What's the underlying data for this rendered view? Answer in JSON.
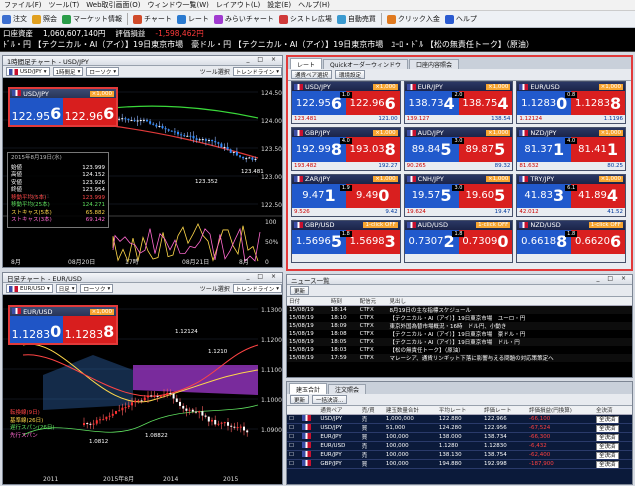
{
  "menu": [
    "ファイル(F)",
    "ツール(T)",
    "Web取引画面(O)",
    "ウィンドウ一覧(W)",
    "レイアウト(L)",
    "設定(E)",
    "ヘルプ(H)"
  ],
  "toolbar": [
    {
      "label": "注文",
      "icon": "order-icon",
      "color": "#3c6fd0"
    },
    {
      "label": "照会",
      "icon": "inquiry-icon",
      "color": "#e0a020"
    },
    {
      "label": "マーケット情報",
      "icon": "market-info-icon",
      "color": "#2a9d4a"
    },
    {
      "label": "チャート",
      "icon": "chart-icon",
      "color": "#d04a2a"
    },
    {
      "label": "レート",
      "icon": "rate-icon",
      "color": "#2a7ad0"
    },
    {
      "label": "みらいチャート",
      "icon": "mirai-chart-icon",
      "color": "#a03ad0"
    },
    {
      "label": "シストレ広場",
      "icon": "systrade-icon",
      "color": "#d03a3a"
    },
    {
      "label": "自動売買",
      "icon": "auto-trade-icon",
      "color": "#3a9ad0"
    },
    {
      "label": "クリック入金",
      "icon": "deposit-icon",
      "color": "#e07a20"
    },
    {
      "label": "ヘルプ",
      "icon": "help-icon",
      "color": "#2a5ad0"
    }
  ],
  "status": {
    "equity_label": "口座資産",
    "equity": "1,060,607,140",
    "unit": "円",
    "pl_label": "評価損益",
    "pl": "-1,598,462",
    "pl_unit": "円"
  },
  "ticker": "ﾄﾞﾙ・円     【テクニカル・AI（アイ）】19日東京市場　豪ドル・円     【テクニカル・AI（アイ）】19日東京市場　ﾕｰﾛ・ﾄﾞﾙ     【松の無責任トーク】（原油）",
  "chart1": {
    "title": "1時間足チャート - USD/JPY",
    "pair": "USD/JPY",
    "timeframe": "1時間足",
    "candle": "ローソク",
    "tool": "ツール選択",
    "line": "トレンドライン",
    "quote": {
      "pair": "USD/JPY",
      "lot": "×1,000",
      "bid": "122.95",
      "bid_pip": "6",
      "ask": "122.96",
      "ask_pip": "6",
      "spread": "1.0"
    },
    "y_labels": [
      "124.50",
      "124.00",
      "123.50",
      "123.00",
      "122.50"
    ],
    "y2_labels": [
      "100",
      "50%",
      "0"
    ],
    "x_labels": [
      "8月",
      "08月20日",
      "17時",
      "08月21日",
      "8月"
    ],
    "annotations": [
      "123.481",
      "123.352",
      "121.001"
    ],
    "info": {
      "date": "2015年8月19日(水)",
      "rows": [
        [
          "始値",
          "123.999"
        ],
        [
          "高値",
          "124.152"
        ],
        [
          "安値",
          "123.926"
        ],
        [
          "終値",
          "123.954"
        ]
      ],
      "ind": [
        [
          "移動平均(5本)",
          "123.999",
          "red"
        ],
        [
          "移動平均(25本)",
          "124.271",
          "grn"
        ],
        [
          "ストキャス(5本)",
          "65.882",
          "yel"
        ],
        [
          "ストキャス(3本)",
          "69.142",
          "pnk"
        ]
      ]
    }
  },
  "chart2": {
    "title": "日足チャート - EUR/USD",
    "pair": "EUR/USD",
    "timeframe": "日足",
    "candle": "ローソク",
    "tool": "ツール選択",
    "line": "トレンドライン",
    "quote": {
      "pair": "EUR/USD",
      "lot": "×1,000",
      "bid": "1.1283",
      "bid_pip": "0",
      "ask": "1.1283",
      "ask_pip": "8",
      "spread": "0.8"
    },
    "y_labels": [
      "1.1300",
      "1.1200",
      "1.1100",
      "1.1000",
      "1.0900"
    ],
    "x_labels": [
      "2011",
      "2015年8月",
      "2014",
      "2015"
    ],
    "annotations": [
      "1.12124",
      "1.08822",
      "1.1210",
      "1.0812"
    ],
    "legend": [
      [
        "転換線(9日)",
        "#ff4444"
      ],
      [
        "基準線(26日)",
        "#ffd84a"
      ],
      [
        "遅行スパン(26日)",
        "#5fe05f"
      ],
      [
        "先行スパン",
        "#ff6ad0"
      ]
    ]
  },
  "rate": {
    "title": "レート",
    "tabs": [
      "レート",
      "Quickオーダーウィンドウ",
      "口座内容照会"
    ],
    "buttons": [
      "通貨ペア選択",
      "環境設定"
    ],
    "tiles": [
      {
        "pair": "USD/JPY",
        "lot": "×1,000",
        "bid": "122.95",
        "bp": "6",
        "ask": "122.96",
        "ap": "6",
        "sp": "1.0",
        "lo": "123.481",
        "hi": "121.00"
      },
      {
        "pair": "EUR/JPY",
        "lot": "×1,000",
        "bid": "138.73",
        "bp": "4",
        "ask": "138.75",
        "ap": "4",
        "sp": "2.0",
        "lo": "139.127",
        "hi": "138.54"
      },
      {
        "pair": "EUR/USD",
        "lot": "×1,000",
        "bid": "1.1283",
        "bp": "0",
        "ask": "1.1283",
        "ap": "8",
        "sp": "0.8",
        "lo": "1.12124",
        "hi": "1.1196"
      },
      {
        "pair": "GBP/JPY",
        "lot": "×1,000",
        "bid": "192.99",
        "bp": "8",
        "ask": "193.03",
        "ap": "8",
        "sp": "4.0",
        "lo": "193.482",
        "hi": "192.27"
      },
      {
        "pair": "AUD/JPY",
        "lot": "×1,000",
        "bid": "89.84",
        "bp": "5",
        "ask": "89.87",
        "ap": "5",
        "sp": "3.0",
        "lo": "90.265",
        "hi": "89.32"
      },
      {
        "pair": "NZD/JPY",
        "lot": "×1,000",
        "bid": "81.37",
        "bp": "1",
        "ask": "81.41",
        "ap": "1",
        "sp": "4.0",
        "lo": "81.632",
        "hi": "80.25"
      },
      {
        "pair": "ZAR/JPY",
        "lot": "×1,000",
        "bid": "9.47",
        "bp": "1",
        "ask": "9.49",
        "ap": "0",
        "sp": "1.9",
        "lo": "9.526",
        "hi": "9.42"
      },
      {
        "pair": "CNH/JPY",
        "lot": "×1,000",
        "bid": "19.57",
        "bp": "5",
        "ask": "19.60",
        "ap": "5",
        "sp": "3.0",
        "lo": "19.624",
        "hi": "19.47"
      },
      {
        "pair": "TRY/JPY",
        "lot": "×1,000",
        "bid": "41.83",
        "bp": "3",
        "ask": "41.89",
        "ap": "4",
        "sp": "6.1",
        "lo": "42.012",
        "hi": "41.52"
      },
      {
        "pair": "GBP/USD",
        "lot": "1-click OFF",
        "bid": "1.5696",
        "bp": "5",
        "ask": "1.5698",
        "ap": "3",
        "sp": "1.8",
        "lo": "",
        "hi": ""
      },
      {
        "pair": "AUD/USD",
        "lot": "1-click OFF",
        "bid": "0.7307",
        "bp": "2",
        "ask": "0.7309",
        "ap": "0",
        "sp": "1.8",
        "lo": "",
        "hi": ""
      },
      {
        "pair": "NZD/USD",
        "lot": "1-click OFF",
        "bid": "0.6618",
        "bp": "8",
        "ask": "0.6620",
        "ap": "6",
        "sp": "1.8",
        "lo": "",
        "hi": ""
      }
    ]
  },
  "news": {
    "title": "ニュース一覧",
    "refresh": "更新",
    "headers": [
      "日付",
      "時刻",
      "配信元",
      "見出し"
    ],
    "rows": [
      [
        "15/08/19",
        "18:14",
        "CTFX",
        "8月19日の主な指標スケジュール"
      ],
      [
        "15/08/19",
        "18:10",
        "CTFX",
        "【テクニカル・AI（アイ）】19日東京市場　ユーロ・円"
      ],
      [
        "15/08/19",
        "18:09",
        "CTFX",
        "東京外国為替市場概況・16時　ドル円、小動き"
      ],
      [
        "15/08/19",
        "18:08",
        "CTFX",
        "【テクニカル・AI（アイ）】19日東京市場　豪ドル・円"
      ],
      [
        "15/08/19",
        "18:05",
        "CTFX",
        "【テクニカル・AI（アイ）】19日東京市場　ドル・円"
      ],
      [
        "15/08/19",
        "18:03",
        "CTFX",
        "【松の無責任トーク】（原油）"
      ],
      [
        "15/08/19",
        "17:59",
        "CTFX",
        "マレーシア、通貨リンギット下落に影響与える問題の対応策策定へ"
      ]
    ]
  },
  "positions": {
    "tabs": [
      "建玉合計",
      "注文照会"
    ],
    "title": "建玉合計",
    "buttons": [
      "更新",
      "一括決済..."
    ],
    "headers": [
      "通貨ペア",
      "売/買",
      "建玉数量合計",
      "平均レート",
      "評価レート",
      "評価損益(円換算)",
      "全決済"
    ],
    "rows": [
      [
        "USD/JPY",
        "売",
        "1,000,000",
        "122.880",
        "122.966",
        "-66,100",
        "全決済"
      ],
      [
        "USD/JPY",
        "買",
        "51,000",
        "124.280",
        "122.956",
        "-67,524",
        "全決済"
      ],
      [
        "EUR/JPY",
        "買",
        "100,000",
        "138.000",
        "138.734",
        "-66,300",
        "全決済"
      ],
      [
        "EUR/USD",
        "売",
        "100,000",
        "1.1280",
        "1.12830",
        "-6,432",
        "全決済"
      ],
      [
        "EUR/JPY",
        "売",
        "100,000",
        "138.130",
        "138.754",
        "-62,400",
        "全決済"
      ],
      [
        "GBP/JPY",
        "買",
        "100,000",
        "194.880",
        "192.998",
        "-187,900",
        "全決済"
      ]
    ]
  },
  "colors": {
    "bid": "#2159cc",
    "ask": "#d91f1f",
    "highlight": "#e23a3a",
    "panel_bg": "#000000"
  }
}
